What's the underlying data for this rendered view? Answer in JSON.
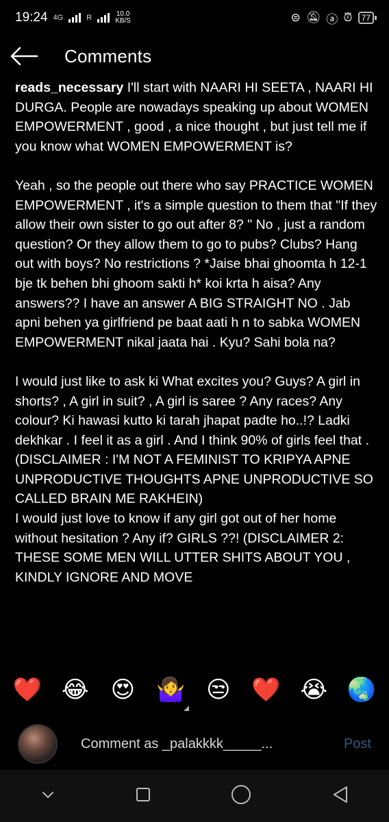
{
  "status_bar": {
    "time": "19:24",
    "network_label": "4G",
    "carrier_label": "R",
    "speed_value": "10.0",
    "speed_unit": "KB/S",
    "battery": "77"
  },
  "header": {
    "title": "Comments"
  },
  "comment": {
    "username": "reads_necessary",
    "paragraphs": [
      "I'll start with NAARI HI SEETA , NAARI HI DURGA. People are nowadays speaking up about WOMEN EMPOWERMENT , good , a nice thought , but just tell me if you know what WOMEN EMPOWERMENT is?",
      "Yeah , so the people out there who say PRACTICE WOMEN EMPOWERMENT , it's a simple question to them that \"If they allow their own sister to go out after 8? \" No , just a random question? Or they allow them to go to pubs? Clubs? Hang out with boys? No restrictions ? *Jaise bhai ghoomta h 12-1 bje tk behen bhi ghoom sakti h* koi krta h aisa? Any answers?? I have an answer A BIG STRAIGHT NO . Jab apni behen ya girlfriend pe baat aati h n to sabka WOMEN EMPOWERMENT nikal jaata hai . Kyu? Sahi bola na?",
      "I would just like to ask ki What excites you? Guys? A girl in shorts? , A girl in suit? , A girl is saree ? Any races? Any colour? Ki hawasi kutto ki tarah jhapat padte ho..!? Ladki dekhkar . I feel it as a girl . And I think 90% of girls feel that . (DISCLAIMER : I'M NOT A FEMINIST TO KRIPYA APNE UNPRODUCTIVE THOUGHTS APNE UNPRODUCTIVE SO CALLED BRAIN ME RAKHEIN)",
      "I would just love to know if any girl got out of her home without hesitation ? Any if? GIRLS ??! (DISCLAIMER 2: THESE SOME MEN WILL UTTER SHITS ABOUT YOU , KINDLY IGNORE AND MOVE"
    ]
  },
  "emoji_bar": [
    "❤️",
    "😂",
    "😍",
    "🤷‍♀️",
    "😒",
    "❤️",
    "😭",
    "🌏"
  ],
  "comment_input": {
    "placeholder": "Comment as _palakkkk_____...",
    "post_label": "Post"
  },
  "colors": {
    "background": "#000000",
    "post_disabled": "#2f5a87",
    "nav_bar": "#111111"
  },
  "icons": {
    "back": "left-arrow-icon",
    "nav_back": "chevron-down-icon",
    "nav_home": "circle-home-icon",
    "nav_recents": "square-recents-icon",
    "nav_triangle": "triangle-back-icon"
  }
}
